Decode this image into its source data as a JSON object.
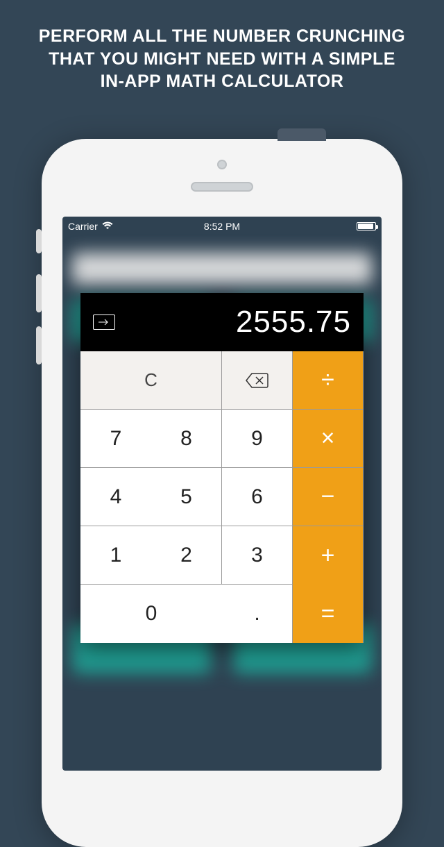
{
  "headline": {
    "line1": "PERFORM ALL THE NUMBER CRUNCHING",
    "line2": "THAT YOU MIGHT NEED WITH A SIMPLE",
    "line3": "IN-APP MATH CALCULATOR"
  },
  "statusbar": {
    "carrier": "Carrier",
    "time": "8:52 PM"
  },
  "calculator": {
    "display": "2555.75",
    "keys": {
      "clear": "C",
      "divide": "÷",
      "n7": "7",
      "n8": "8",
      "n9": "9",
      "multiply": "×",
      "n4": "4",
      "n5": "5",
      "n6": "6",
      "minus": "−",
      "n1": "1",
      "n2": "2",
      "n3": "3",
      "plus": "+",
      "n0": "0",
      "decimal": ".",
      "equals": "="
    }
  }
}
